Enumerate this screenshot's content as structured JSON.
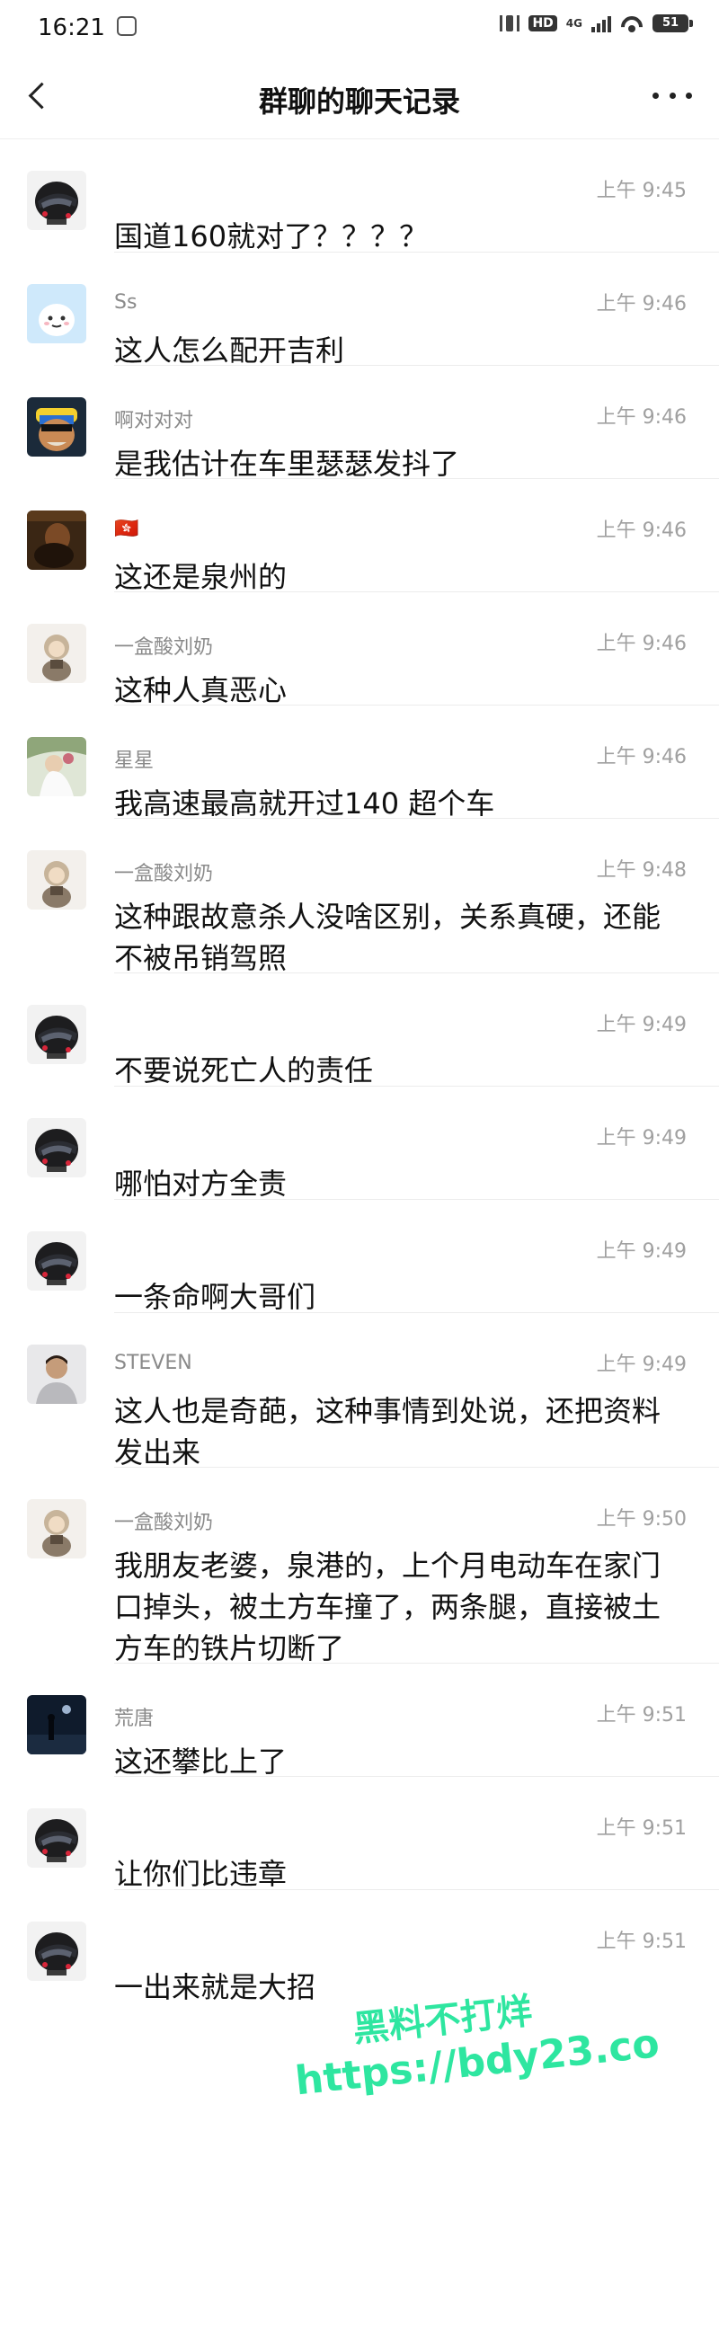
{
  "status_bar": {
    "time": "16:21",
    "hd_label": "HD",
    "network_label": "4G",
    "battery": "51"
  },
  "nav": {
    "title": "群聊的聊天记录"
  },
  "messages": [
    {
      "sender": "",
      "time": "上午 9:45",
      "text": "国道160就对了？？？？",
      "avatar": "helmet"
    },
    {
      "sender": "Ss",
      "time": "上午 9:46",
      "text": "这人怎么配开吉利",
      "avatar": "cartoon"
    },
    {
      "sender": "啊对对对",
      "time": "上午 9:46",
      "text": "是我估计在车里瑟瑟发抖了",
      "avatar": "toy"
    },
    {
      "sender": "🇭🇰",
      "time": "上午 9:46",
      "text": "这还是泉州的",
      "avatar": "dark"
    },
    {
      "sender": "一盒酸刘奶",
      "time": "上午 9:46",
      "text": "这种人真恶心",
      "avatar": "doll"
    },
    {
      "sender": "星星",
      "time": "上午 9:46",
      "text": "我高速最高就开过140 超个车",
      "avatar": "bride"
    },
    {
      "sender": "一盒酸刘奶",
      "time": "上午 9:48",
      "text": "这种跟故意杀人没啥区别，关系真硬，还能不被吊销驾照",
      "avatar": "doll"
    },
    {
      "sender": "",
      "time": "上午 9:49",
      "text": "不要说死亡人的责任",
      "avatar": "helmet"
    },
    {
      "sender": "",
      "time": "上午 9:49",
      "text": "哪怕对方全责",
      "avatar": "helmet"
    },
    {
      "sender": "",
      "time": "上午 9:49",
      "text": "一条命啊大哥们",
      "avatar": "helmet"
    },
    {
      "sender": "STEVEN",
      "time": "上午 9:49",
      "text": "这人也是奇葩，这种事情到处说，还把资料发出来",
      "avatar": "man"
    },
    {
      "sender": "一盒酸刘奶",
      "time": "上午 9:50",
      "text": "我朋友老婆，泉港的，上个月电动车在家门口掉头，被土方车撞了，两条腿，直接被土方车的铁片切断了",
      "avatar": "doll"
    },
    {
      "sender": "荒唐",
      "time": "上午 9:51",
      "text": "这还攀比上了",
      "avatar": "night"
    },
    {
      "sender": "",
      "time": "上午 9:51",
      "text": "让你们比违章",
      "avatar": "helmet"
    },
    {
      "sender": "",
      "time": "上午 9:51",
      "text": "一出来就是大招",
      "avatar": "helmet"
    }
  ],
  "watermark": {
    "line1": "黑料不打烊",
    "line2": "https://bdy23.co"
  },
  "colors": {
    "background": "#ffffff",
    "meta_text": "#8a8a8a",
    "divider": "#ececec",
    "watermark": "#2ee6a0"
  }
}
